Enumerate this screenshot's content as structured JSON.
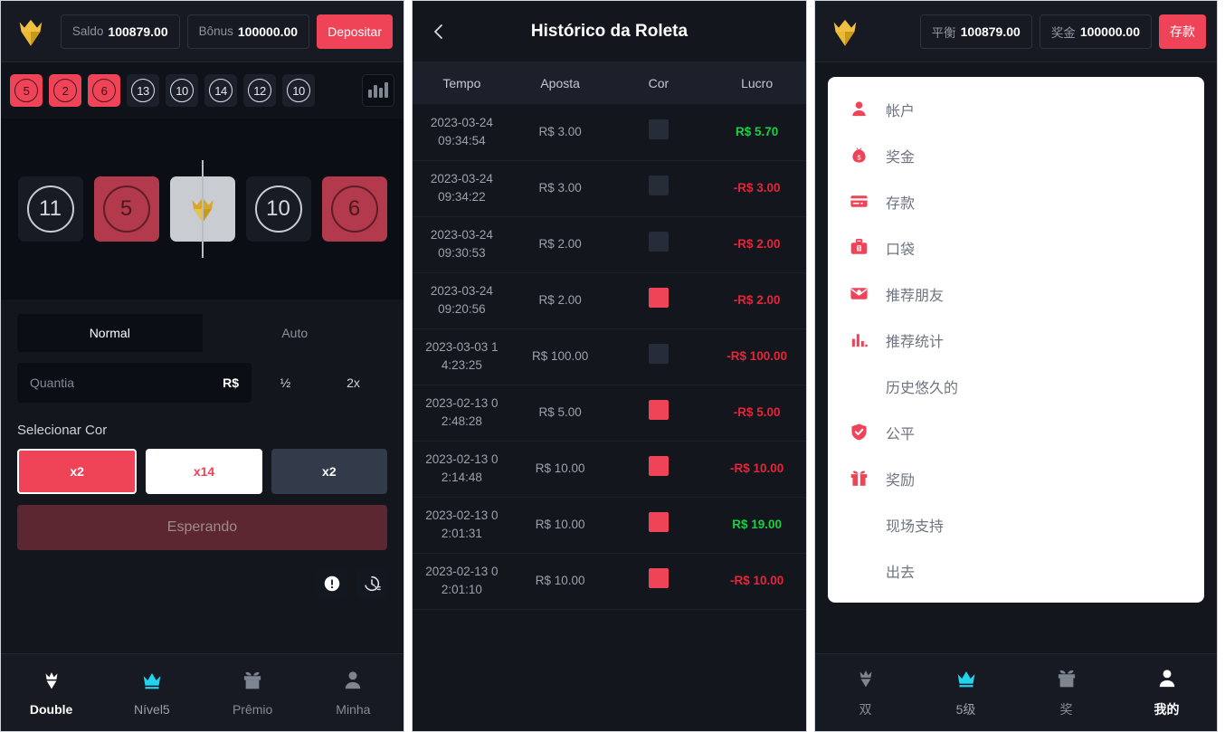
{
  "left": {
    "topbar": {
      "logo_icon": "crown-diamond-logo",
      "balance_label": "Saldo",
      "balance_value": "100879.00",
      "bonus_label": "Bônus",
      "bonus_value": "100000.00",
      "deposit_label": "Depositar"
    },
    "history_strip": {
      "chips": [
        {
          "value": "5",
          "color": "red"
        },
        {
          "value": "2",
          "color": "red"
        },
        {
          "value": "6",
          "color": "red"
        },
        {
          "value": "13",
          "color": "black"
        },
        {
          "value": "10",
          "color": "black"
        },
        {
          "value": "14",
          "color": "black"
        },
        {
          "value": "12",
          "color": "black"
        },
        {
          "value": "10",
          "color": "black"
        }
      ],
      "chart_icon": "bar-chart-icon"
    },
    "wheel": {
      "tiles": [
        {
          "value": "11",
          "color": "black"
        },
        {
          "value": "5",
          "color": "red"
        },
        {
          "value": "",
          "color": "white",
          "icon": "crown-diamond-logo"
        },
        {
          "value": "10",
          "color": "black"
        },
        {
          "value": "6",
          "color": "red"
        }
      ]
    },
    "modes": {
      "normal": "Normal",
      "auto": "Auto",
      "active": "Normal"
    },
    "amount": {
      "placeholder": "Quantia",
      "value": "",
      "currency": "R$",
      "half_label": "½",
      "double_label": "2x"
    },
    "select_color": {
      "title": "Selecionar Cor",
      "options": [
        {
          "label": "x2",
          "style": "red",
          "selected": true
        },
        {
          "label": "x14",
          "style": "white",
          "selected": false
        },
        {
          "label": "x2",
          "style": "dark",
          "selected": false
        }
      ]
    },
    "action_button": "Esperando",
    "utils": [
      {
        "icon": "info-circle-icon"
      },
      {
        "icon": "history-clock-icon"
      }
    ],
    "bottomnav": [
      {
        "label": "Double",
        "icon": "crown-diamond-icon",
        "state": "active"
      },
      {
        "label": "Nível5",
        "icon": "crown-icon",
        "state": "level"
      },
      {
        "label": "Prêmio",
        "icon": "gift-icon",
        "state": "normal"
      },
      {
        "label": "Minha",
        "icon": "person-icon",
        "state": "normal"
      }
    ]
  },
  "middle": {
    "back_icon": "chevron-left-icon",
    "title": "Histórico da Roleta",
    "columns": [
      "Tempo",
      "Aposta",
      "Cor",
      "Lucro"
    ],
    "rows": [
      {
        "time": "2023-03-24\n09:34:54",
        "bet": "R$ 3.00",
        "color": "black",
        "profit": "R$ 5.70",
        "sign": "pos"
      },
      {
        "time": "2023-03-24\n09:34:22",
        "bet": "R$ 3.00",
        "color": "black",
        "profit": "-R$ 3.00",
        "sign": "neg"
      },
      {
        "time": "2023-03-24\n09:30:53",
        "bet": "R$ 2.00",
        "color": "black",
        "profit": "-R$ 2.00",
        "sign": "neg"
      },
      {
        "time": "2023-03-24\n09:20:56",
        "bet": "R$ 2.00",
        "color": "red",
        "profit": "-R$ 2.00",
        "sign": "neg"
      },
      {
        "time": "2023-03-03 1\n4:23:25",
        "bet": "R$ 100.00",
        "color": "black",
        "profit": "-R$ 100.00",
        "sign": "neg"
      },
      {
        "time": "2023-02-13 0\n2:48:28",
        "bet": "R$ 5.00",
        "color": "red",
        "profit": "-R$ 5.00",
        "sign": "neg"
      },
      {
        "time": "2023-02-13 0\n2:14:48",
        "bet": "R$ 10.00",
        "color": "red",
        "profit": "-R$ 10.00",
        "sign": "neg"
      },
      {
        "time": "2023-02-13 0\n2:01:31",
        "bet": "R$ 10.00",
        "color": "red",
        "profit": "R$ 19.00",
        "sign": "pos"
      },
      {
        "time": "2023-02-13 0\n2:01:10",
        "bet": "R$ 10.00",
        "color": "red",
        "profit": "-R$ 10.00",
        "sign": "neg"
      }
    ]
  },
  "right": {
    "topbar": {
      "logo_icon": "crown-diamond-logo",
      "balance_label": "平衡",
      "balance_value": "100879.00",
      "bonus_label": "奖金",
      "bonus_value": "100000.00",
      "deposit_label": "存款"
    },
    "menu": [
      {
        "label": "帐户",
        "icon": "person-icon"
      },
      {
        "label": "奖金",
        "icon": "money-bag-icon"
      },
      {
        "label": "存款",
        "icon": "credit-card-icon"
      },
      {
        "label": "口袋",
        "icon": "briefcase-icon"
      },
      {
        "label": "推荐朋友",
        "icon": "envelope-icon"
      },
      {
        "label": "推荐统计",
        "icon": "bar-chart-icon"
      },
      {
        "label": "历史悠久的",
        "icon": "none"
      },
      {
        "label": "公平",
        "icon": "shield-check-icon"
      },
      {
        "label": "奖励",
        "icon": "gift-icon"
      },
      {
        "label": "现场支持",
        "icon": "none"
      },
      {
        "label": "出去",
        "icon": "none"
      }
    ],
    "bottomnav": [
      {
        "label": "双",
        "icon": "crown-diamond-icon",
        "state": "normal"
      },
      {
        "label": "5级",
        "icon": "crown-icon",
        "state": "level"
      },
      {
        "label": "奖",
        "icon": "gift-icon",
        "state": "normal"
      },
      {
        "label": "我的",
        "icon": "person-icon",
        "state": "active"
      }
    ]
  },
  "colors": {
    "accent_red": "#ef4458",
    "profit_green": "#17d043",
    "loss_red": "#e5253a",
    "cyan": "#22d3ee",
    "panel_bg": "#13161d"
  }
}
